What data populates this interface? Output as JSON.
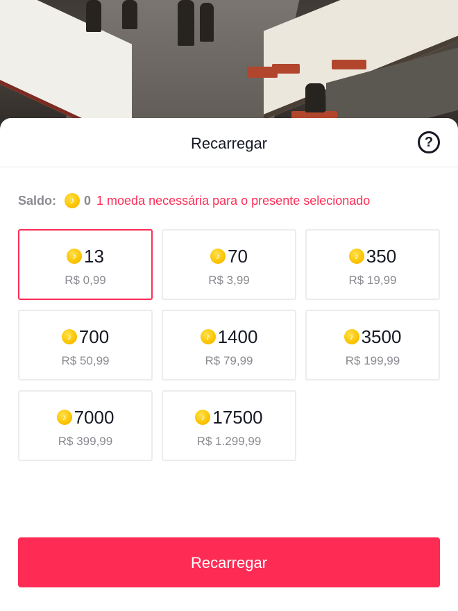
{
  "header": {
    "title": "Recarregar",
    "help_icon": "question-circle-icon",
    "help_symbol": "?"
  },
  "balance": {
    "label": "Saldo:",
    "coin_icon": "coin-icon",
    "value": "0",
    "warning": "1 moeda necessária para o presente selecionado",
    "warning_color": "#fe2c55"
  },
  "packages": [
    {
      "coins": "13",
      "price": "R$ 0,99",
      "selected": true
    },
    {
      "coins": "70",
      "price": "R$ 3,99",
      "selected": false
    },
    {
      "coins": "350",
      "price": "R$ 19,99",
      "selected": false
    },
    {
      "coins": "700",
      "price": "R$ 50,99",
      "selected": false
    },
    {
      "coins": "1400",
      "price": "R$ 79,99",
      "selected": false
    },
    {
      "coins": "3500",
      "price": "R$ 199,99",
      "selected": false
    },
    {
      "coins": "7000",
      "price": "R$ 399,99",
      "selected": false
    },
    {
      "coins": "17500",
      "price": "R$ 1.299,99",
      "selected": false
    }
  ],
  "footer": {
    "recharge_label": "Recarregar"
  },
  "colors": {
    "accent": "#fe2c55",
    "coin": "#fbc400",
    "muted_text": "#8a8b91",
    "text": "#161823"
  }
}
